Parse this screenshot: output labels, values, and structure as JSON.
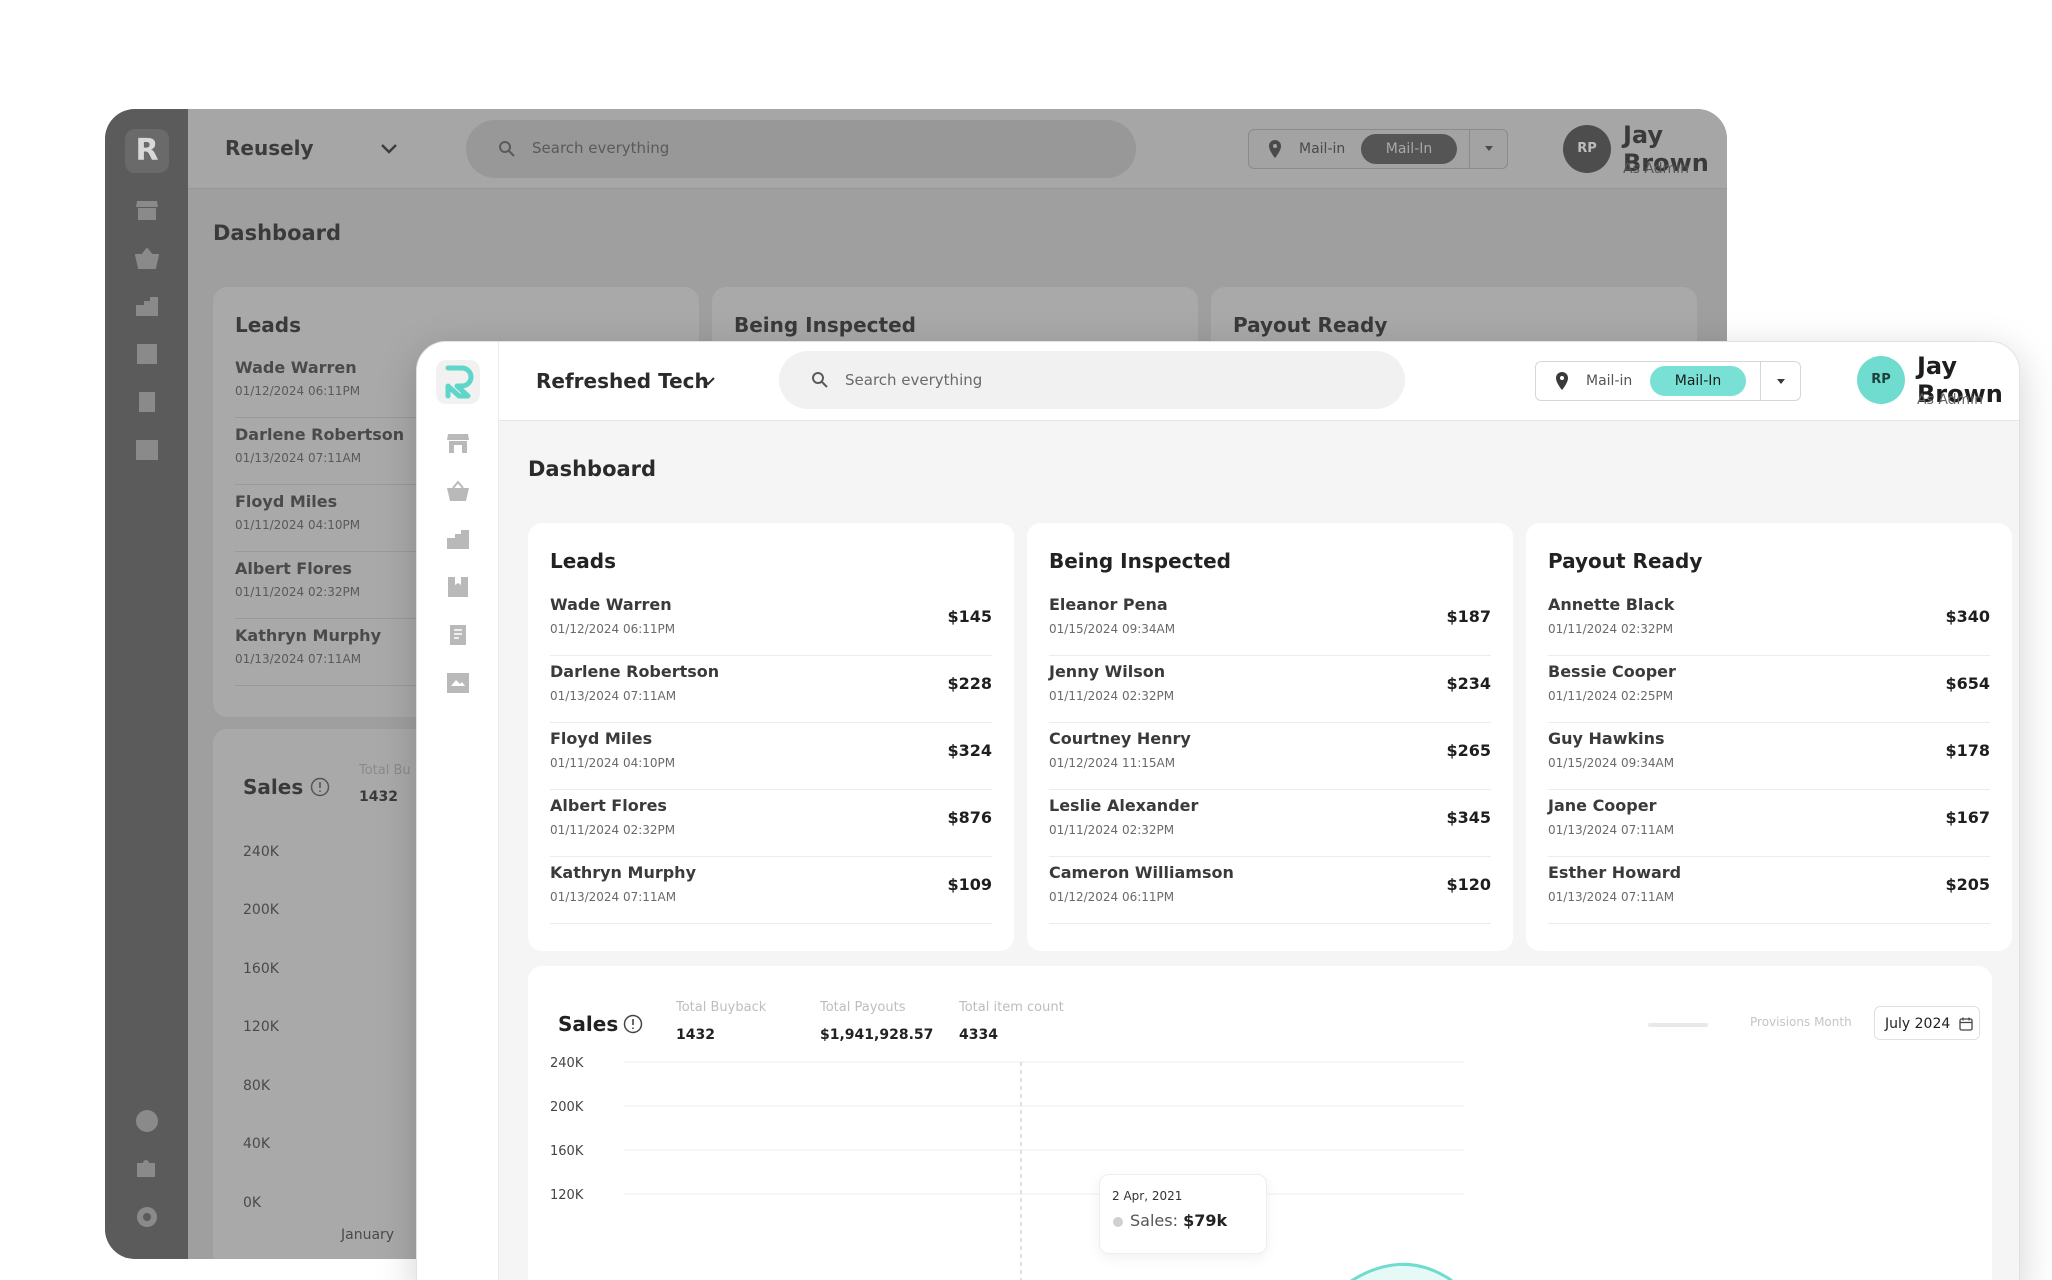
{
  "back_window": {
    "brand": "Reusely",
    "logo_letter": "R",
    "search_placeholder": "Search everything",
    "toggle_option_1": "Mail-in",
    "toggle_option_2": "Mail-In",
    "avatar_initials": "RP",
    "user_name": "Jay Brown",
    "user_role": "As Admin",
    "page_title": "Dashboard",
    "cards": [
      {
        "title": "Leads",
        "rows": [
          {
            "name": "Wade Warren",
            "date": "01/12/2024 06:11PM"
          },
          {
            "name": "Darlene Robertson",
            "date": "01/13/2024 07:11AM"
          },
          {
            "name": "Floyd Miles",
            "date": "01/11/2024 04:10PM"
          },
          {
            "name": "Albert Flores",
            "date": "01/11/2024 02:32PM"
          },
          {
            "name": "Kathryn Murphy",
            "date": "01/13/2024 07:11AM"
          }
        ]
      },
      {
        "title": "Being Inspected",
        "rows": []
      },
      {
        "title": "Payout Ready",
        "rows": []
      }
    ],
    "sales": {
      "title": "Sales",
      "stat_label": "Total Bu",
      "stat_value": "1432",
      "y_labels": [
        "240K",
        "200K",
        "160K",
        "120K",
        "80K",
        "40K",
        "0K"
      ],
      "x_label": "January"
    }
  },
  "front_window": {
    "brand": "Refreshed Tech",
    "search_placeholder": "Search everything",
    "toggle_option_1": "Mail-in",
    "toggle_option_2": "Mail-In",
    "avatar_initials": "RP",
    "user_name": "Jay Brown",
    "user_role": "As Admin",
    "page_title": "Dashboard",
    "cards": [
      {
        "title": "Leads",
        "rows": [
          {
            "name": "Wade Warren",
            "date": "01/12/2024 06:11PM",
            "amount": "$145"
          },
          {
            "name": "Darlene Robertson",
            "date": "01/13/2024 07:11AM",
            "amount": "$228"
          },
          {
            "name": "Floyd Miles",
            "date": "01/11/2024 04:10PM",
            "amount": "$324"
          },
          {
            "name": "Albert Flores",
            "date": "01/11/2024 02:32PM",
            "amount": "$876"
          },
          {
            "name": "Kathryn Murphy",
            "date": "01/13/2024 07:11AM",
            "amount": "$109"
          }
        ]
      },
      {
        "title": "Being Inspected",
        "rows": [
          {
            "name": "Eleanor Pena",
            "date": "01/15/2024 09:34AM",
            "amount": "$187"
          },
          {
            "name": "Jenny Wilson",
            "date": "01/11/2024 02:32PM",
            "amount": "$234"
          },
          {
            "name": "Courtney Henry",
            "date": "01/12/2024 11:15AM",
            "amount": "$265"
          },
          {
            "name": "Leslie Alexander",
            "date": "01/11/2024 02:32PM",
            "amount": "$345"
          },
          {
            "name": "Cameron Williamson",
            "date": "01/12/2024 06:11PM",
            "amount": "$120"
          }
        ]
      },
      {
        "title": "Payout Ready",
        "rows": [
          {
            "name": "Annette Black",
            "date": "01/11/2024 02:32PM",
            "amount": "$340"
          },
          {
            "name": "Bessie Cooper",
            "date": "01/11/2024 02:25PM",
            "amount": "$654"
          },
          {
            "name": "Guy Hawkins",
            "date": "01/15/2024 09:34AM",
            "amount": "$178"
          },
          {
            "name": "Jane Cooper",
            "date": "01/13/2024 07:11AM",
            "amount": "$167"
          },
          {
            "name": "Esther Howard",
            "date": "01/13/2024 07:11AM",
            "amount": "$205"
          }
        ]
      }
    ],
    "sales": {
      "title": "Sales",
      "stats": [
        {
          "label": "Total Buyback",
          "value": "1432"
        },
        {
          "label": "Total Payouts",
          "value": "$1,941,928.57"
        },
        {
          "label": "Total item count",
          "value": "4334"
        }
      ],
      "legend_label": "Provisions Month",
      "month_value": "July 2024",
      "tooltip": {
        "date": "2 Apr, 2021",
        "label": "Sales:",
        "value": "$79k"
      }
    }
  },
  "chart_data": {
    "type": "area",
    "y_ticks": [
      "240K",
      "200K",
      "160K",
      "120K"
    ],
    "ylim": [
      0,
      240000
    ],
    "highlight": {
      "date": "2 Apr, 2021",
      "value": 79000
    },
    "series_color": "#6fdccf",
    "grid": true,
    "legend_placement": "top-right"
  },
  "colors": {
    "accent": "#79e0d6",
    "avatar": "#6fdccf",
    "dim_sidebar": "#5b5b5b",
    "dim_overlay": "#9f9f9f"
  },
  "icons": {
    "nav": [
      "store-icon",
      "basket-icon",
      "boxes-icon",
      "bookmark-icon",
      "document-icon",
      "inbox-icon"
    ],
    "bottom": [
      "help-icon",
      "puzzle-icon",
      "settings-icon"
    ]
  }
}
